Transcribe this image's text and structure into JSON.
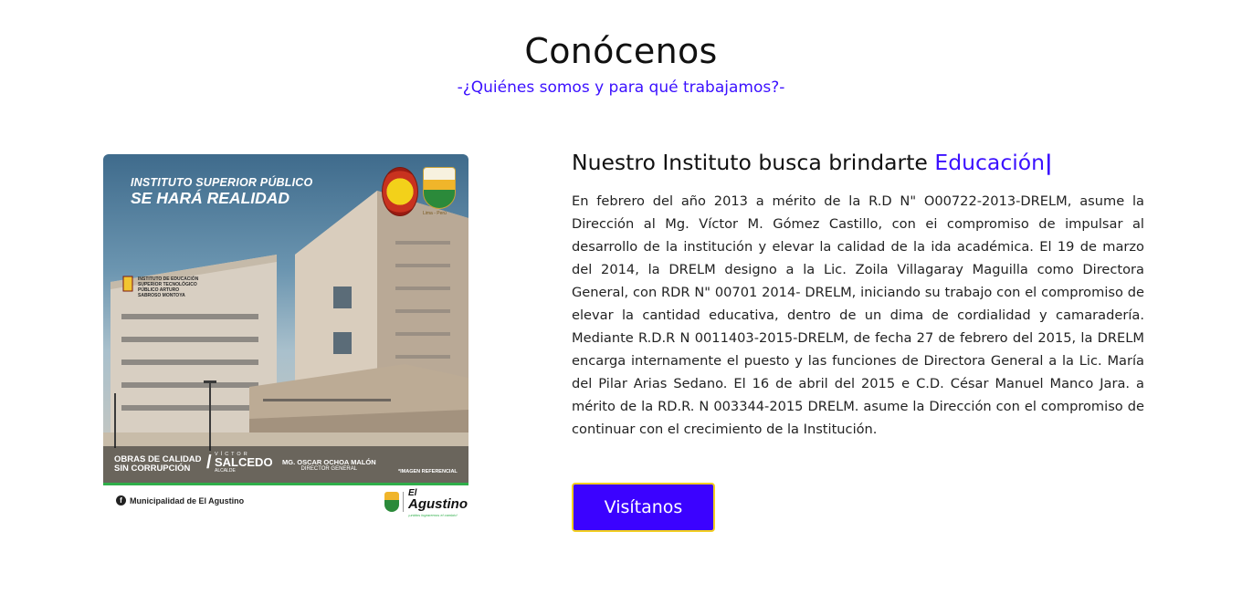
{
  "section": {
    "title": "Conócenos",
    "subtitle": "-¿Quiénes somos y para qué trabajamos?-"
  },
  "poster": {
    "headline_small": "INSTITUTO SUPERIOR PÚBLICO",
    "headline_big": "SE HARÁ REALIDAD",
    "seal_label": "Lima - Perú",
    "facade_text": "INSTITUTO DE EDUCACIÓN SUPERIOR TECNOLÓGICO PÚBLICO ARTURO SABROSO MONTOYA",
    "footer_left_line1": "OBRAS DE CALIDAD",
    "footer_left_line2": "SIN CORRUPCIÓN",
    "mayor_top": "VÍCTOR",
    "mayor_name": "SALCEDO",
    "mayor_role": "ALCALDE",
    "director_name": "MG. OSCAR OCHOA MALÓN",
    "director_role": "DIRECTOR GENERAL",
    "reference_note": "*IMAGEN REFERENCIAL",
    "facebook_page": "Municipalidad de El Agustino",
    "brand_line1": "El",
    "brand_line2": "Agustino",
    "brand_tagline": "¡unidos lograremos el cambio!"
  },
  "content": {
    "heading_prefix": "Nuestro Instituto busca brindarte ",
    "heading_accent": "Educación",
    "heading_cursor": "|",
    "paragraph": "En febrero del año 2013 a mérito de la R.D N\" O00722-2013-DRELM, asume la Dirección al Mg. Víctor M. Gómez Castillo, con ei compromiso de impulsar al desarrollo de la institución y elevar la calidad de la ida académica. El 19 de marzo del 2014, la DRELM designo a la Lic. Zoila Villagaray Maguilla como Directora General, con RDR N\" 00701 2014- DRELM, iniciando su trabajo con el compromiso de elevar la cantidad educativa, dentro de un dima de cordialidad y camaradería. Mediante R.D.R N 0011403-2015-DRELM, de fecha 27 de febrero del 2015, la DRELM encarga internamente el puesto y las funciones de Directora General a la Lic. María del Pilar Arias Sedano. El 16 de abril del 2015 e C.D. César Manuel Manco Jara. a mérito de la RD.R. N 003344-2015 DRELM. asume la Dirección con el compromiso de continuar con el crecimiento de la Institución.",
    "cta_label": "Visítanos"
  },
  "colors": {
    "accent": "#3b10ff",
    "button_bg": "#3b02ff",
    "button_border": "#f2cf20"
  }
}
